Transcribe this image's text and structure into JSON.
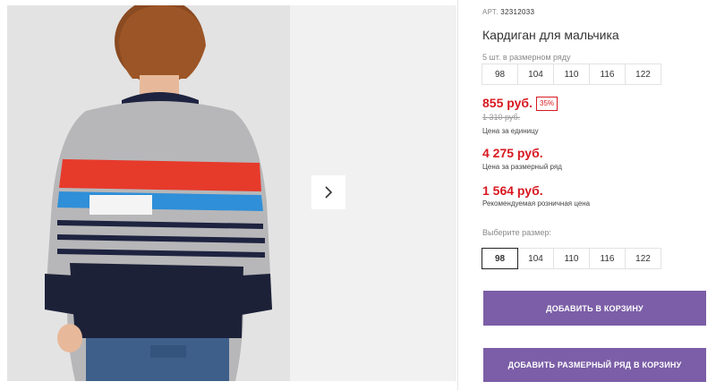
{
  "product": {
    "art_label": "АРТ.",
    "art_number": "32312033",
    "title": "Кардиган для мальчика",
    "row_hint": "5 шт. в размерном ряду",
    "sizes": [
      "98",
      "104",
      "110",
      "116",
      "122"
    ],
    "price": "855 руб.",
    "discount": "35%",
    "old_price": "1 310 руб.",
    "price_caption": "Цена за единицу",
    "row_price": "4 275 руб.",
    "row_price_caption": "Цена за размерный ряд",
    "retail_price": "1 564 руб.",
    "retail_caption": "Рекомендуемая розничная цена",
    "choose_size_label": "Выберите размер:",
    "selected_size": "98",
    "add_to_cart": "ДОБАВИТЬ В КОРЗИНУ",
    "add_row_to_cart": "ДОБАВИТЬ РАЗМЕРНЫЙ РЯД В КОРЗИНУ"
  },
  "colors": {
    "accent": "#7b5ea7",
    "price_red": "#d71920"
  },
  "icons": {
    "next": "chevron-right-icon"
  }
}
